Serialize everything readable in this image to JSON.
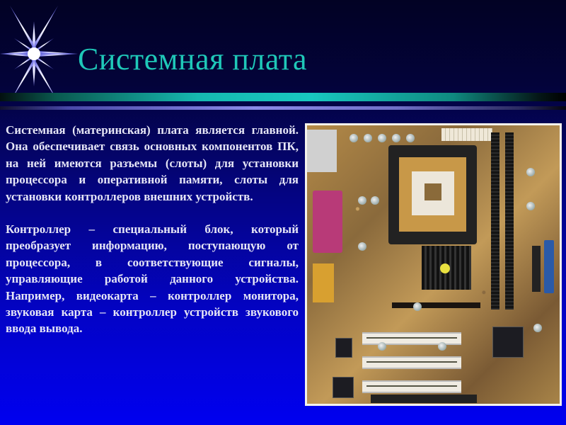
{
  "slide": {
    "title": "Системная плата",
    "paragraphs": [
      "Системная (материнская) плата является главной. Она обеспечивает связь основных компонентов ПК, на ней имеются разъемы (слоты) для установки процессора и оперативной памяти, слоты для установки контроллеров внешних устройств.",
      "Контроллер – специальный блок, который преобразует информацию, поступающую от процессора, в соответствующие сигналы, управляющие работой данного устройства. Например, видеокарта – контроллер монитора, звуковая карта – контроллер устройств звукового ввода вывода."
    ],
    "image": {
      "subject": "motherboard-photo",
      "alt": "Системная плата"
    }
  },
  "colors": {
    "title": "#1fc8b8",
    "text": "#e6e6f6",
    "background_top": "#020224",
    "background_bottom": "#0000f0",
    "accent_bar": "#18c8c0",
    "accent_bar_2": "#8a8ae8"
  }
}
